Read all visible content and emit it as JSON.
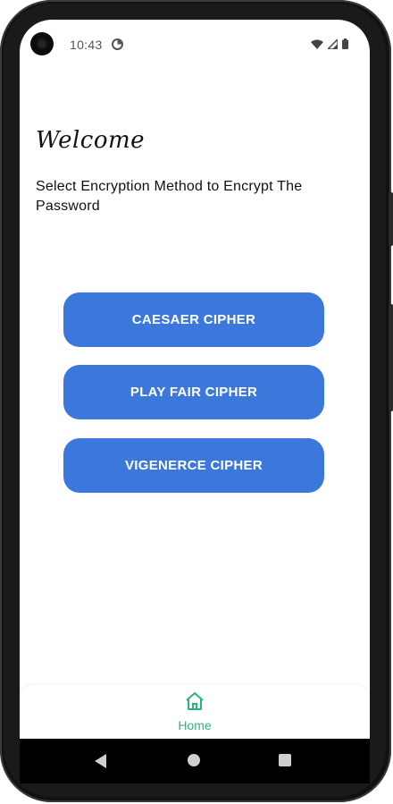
{
  "status_bar": {
    "time": "10:43"
  },
  "main": {
    "welcome": "Welcome",
    "subtitle": "Select Encryption Method to Encrypt The Password",
    "buttons": [
      {
        "label": "CAESAER CIPHER"
      },
      {
        "label": "PLAY FAIR CIPHER"
      },
      {
        "label": "VIGENERCE CIPHER"
      }
    ]
  },
  "bottom_nav": {
    "home_label": "Home",
    "home_icon": "home-icon"
  },
  "colors": {
    "button": "#3c78dc",
    "nav_accent": "#2ab483"
  }
}
